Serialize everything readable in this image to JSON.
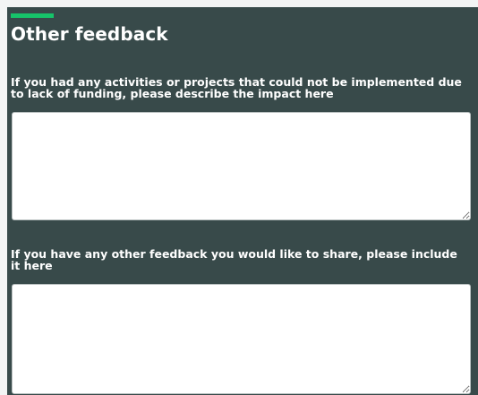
{
  "section": {
    "title": "Other feedback"
  },
  "questions": [
    {
      "label": "If you had any activities or projects that could not be implemented due to lack of funding, please describe the impact here",
      "value": ""
    },
    {
      "label": "If you have any other feedback you would like to share, please include it here",
      "value": ""
    }
  ],
  "colors": {
    "panel_background": "#384a4a",
    "accent": "#16c46a",
    "text": "#ffffff",
    "input_background": "#ffffff"
  }
}
